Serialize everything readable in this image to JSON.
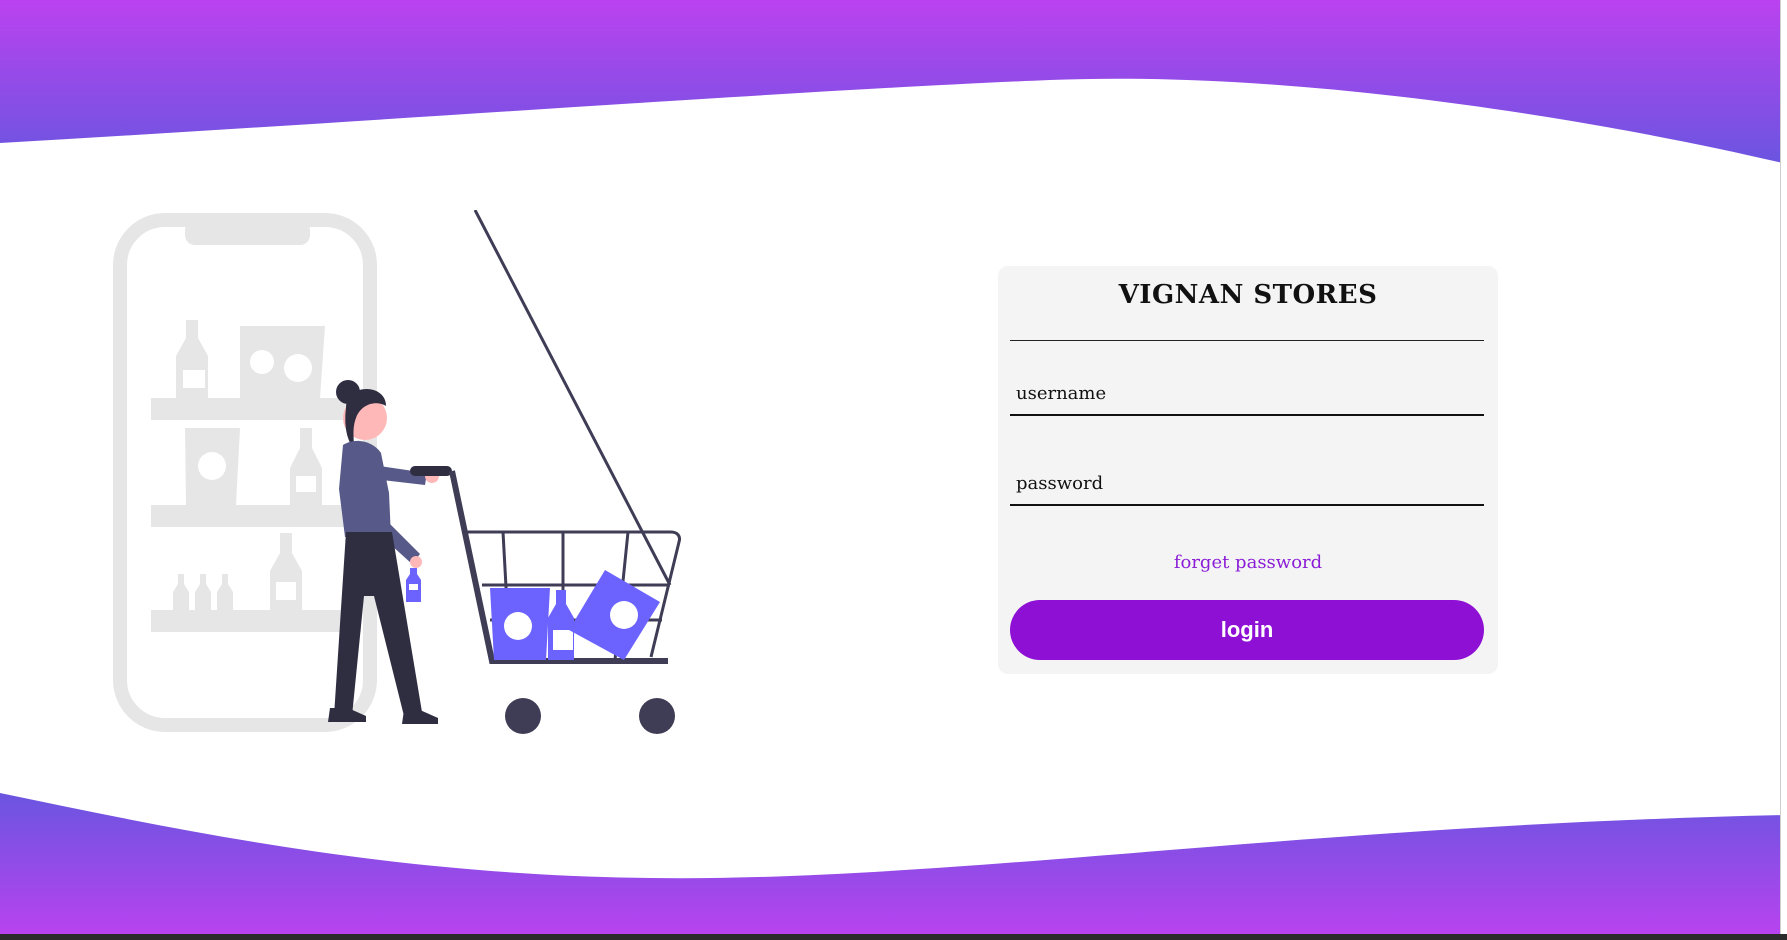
{
  "brand": {
    "gradient_start": "#bb42f0",
    "gradient_end": "#6a55e0",
    "accent": "#8e10d4",
    "illustration_purple": "#6c63ff"
  },
  "login": {
    "title": "VIGNAN STORES",
    "username_placeholder": "username",
    "password_placeholder": "password",
    "forgot_label": "forget password",
    "login_label": "login"
  },
  "illustration": {
    "name": "shopping-cart-illustration"
  }
}
